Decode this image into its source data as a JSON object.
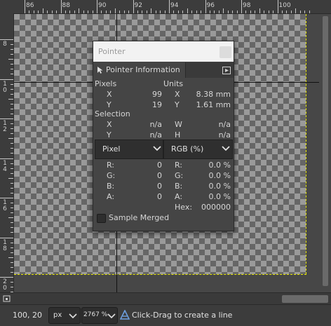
{
  "ruler": {
    "h_labels": [
      "86",
      "88",
      "90",
      "92",
      "94",
      "96",
      "98",
      "100"
    ],
    "v_labels": [
      "8",
      "10",
      "12",
      "14",
      "16",
      "18",
      "20"
    ]
  },
  "dialog": {
    "title": "Pointer",
    "tab_label": "Pointer Information",
    "pixels_header": "Pixels",
    "units_header": "Units",
    "pixels": {
      "x_label": "X",
      "x_value": "99",
      "y_label": "Y",
      "y_value": "19"
    },
    "units": {
      "x_label": "X",
      "x_value": "8.38 mm",
      "y_label": "Y",
      "y_value": "1.61 mm"
    },
    "selection_header": "Selection",
    "selection": {
      "x_label": "X",
      "x_value": "n/a",
      "y_label": "Y",
      "y_value": "n/a",
      "w_label": "W",
      "w_value": "n/a",
      "h_label": "H",
      "h_value": "n/a"
    },
    "left_mode": "Pixel",
    "right_mode": "RGB (%)",
    "left_channels": [
      {
        "label": "R:",
        "value": "0"
      },
      {
        "label": "G:",
        "value": "0"
      },
      {
        "label": "B:",
        "value": "0"
      },
      {
        "label": "A:",
        "value": "0"
      }
    ],
    "right_channels": [
      {
        "label": "R:",
        "value": "0.0 %"
      },
      {
        "label": "G:",
        "value": "0.0 %"
      },
      {
        "label": "B:",
        "value": "0.0 %"
      },
      {
        "label": "A:",
        "value": "0.0 %"
      }
    ],
    "hex_label": "Hex:",
    "hex_value": "000000",
    "sample_merged_label": "Sample Merged",
    "sample_merged_checked": false
  },
  "status": {
    "coords": "100, 20",
    "unit": "px",
    "zoom": "2767 %",
    "message": "Click-Drag to create a line"
  },
  "colors": {
    "canvas_border": "#e5e500",
    "guide": "#111111",
    "message_icon": "#6ea0e0"
  }
}
